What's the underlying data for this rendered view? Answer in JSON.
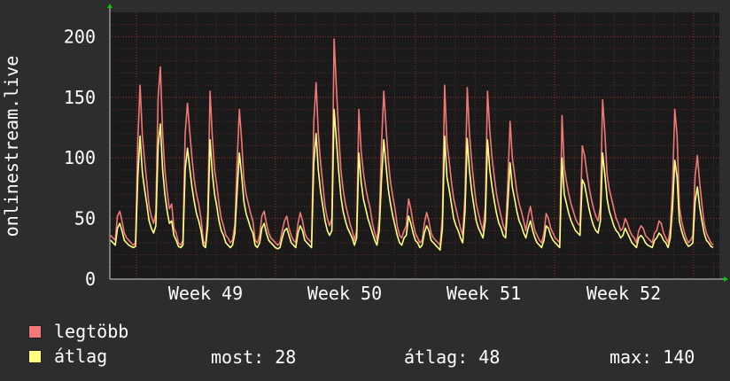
{
  "chart_data": {
    "type": "line",
    "ylabel": "onlinestream.live",
    "ylim": [
      0,
      220
    ],
    "yticks": [
      0,
      50,
      100,
      150,
      200
    ],
    "x_categories": [
      "Week 49",
      "Week 50",
      "Week 51",
      "Week 52"
    ],
    "grid": true,
    "legend_placement": "bottom-left",
    "colors": {
      "background": "#2d2d2d",
      "plot_background": "#1a1a1a",
      "grid_minor": "#5a2a2a",
      "grid_major": "#a03030",
      "max_series": "#f07878",
      "avg_series": "#ffff80",
      "arrow": "#00cc00"
    },
    "series": [
      {
        "name": "legtöbb",
        "color": "#f07878",
        "values": [
          36,
          34,
          32,
          52,
          56,
          48,
          38,
          34,
          32,
          30,
          28,
          30,
          115,
          160,
          118,
          98,
          80,
          60,
          52,
          46,
          55,
          150,
          175,
          120,
          90,
          72,
          58,
          62,
          42,
          38,
          30,
          28,
          32,
          120,
          145,
          122,
          100,
          82,
          70,
          62,
          50,
          32,
          28,
          55,
          155,
          118,
          90,
          78,
          62,
          50,
          44,
          36,
          34,
          30,
          32,
          45,
          95,
          140,
          115,
          82,
          70,
          62,
          54,
          48,
          32,
          30,
          36,
          52,
          56,
          46,
          38,
          34,
          32,
          30,
          28,
          30,
          40,
          48,
          52,
          42,
          36,
          32,
          30,
          46,
          55,
          48,
          38,
          34,
          32,
          30,
          130,
          162,
          120,
          96,
          78,
          60,
          50,
          44,
          50,
          198,
          158,
          122,
          90,
          74,
          62,
          54,
          46,
          40,
          32,
          40,
          140,
          105,
          88,
          75,
          66,
          58,
          46,
          38,
          32,
          50,
          110,
          155,
          126,
          98,
          80,
          68,
          58,
          44,
          36,
          34,
          40,
          44,
          66,
          58,
          46,
          38,
          34,
          30,
          32,
          46,
          55,
          48,
          38,
          34,
          32,
          30,
          28,
          52,
          160,
          112,
          98,
          80,
          66,
          58,
          50,
          42,
          36,
          70,
          158,
          120,
          96,
          78,
          62,
          54,
          46,
          40,
          60,
          155,
          122,
          100,
          84,
          70,
          60,
          52,
          44,
          40,
          80,
          130,
          100,
          86,
          72,
          62,
          56,
          48,
          40,
          52,
          60,
          48,
          40,
          36,
          32,
          30,
          38,
          54,
          50,
          42,
          38,
          34,
          32,
          30,
          135,
          92,
          80,
          70,
          62,
          56,
          50,
          46,
          44,
          110,
          102,
          88,
          76,
          66,
          58,
          52,
          48,
          60,
          148,
          120,
          86,
          74,
          66,
          58,
          50,
          46,
          40,
          42,
          50,
          46,
          40,
          36,
          34,
          30,
          40,
          44,
          42,
          36,
          34,
          32,
          30,
          38,
          40,
          48,
          46,
          38,
          34,
          30,
          42,
          78,
          140,
          118,
          60,
          48,
          40,
          34,
          30,
          32,
          36,
          85,
          102,
          80,
          62,
          46,
          38,
          34,
          30,
          28
        ]
      },
      {
        "name": "átlag",
        "color": "#ffff80",
        "values": [
          32,
          30,
          28,
          42,
          46,
          40,
          32,
          30,
          28,
          27,
          26,
          27,
          85,
          118,
          88,
          74,
          62,
          48,
          42,
          38,
          44,
          110,
          128,
          90,
          70,
          56,
          46,
          48,
          36,
          32,
          27,
          26,
          28,
          90,
          108,
          92,
          76,
          64,
          54,
          48,
          40,
          28,
          26,
          44,
          115,
          88,
          70,
          60,
          48,
          40,
          36,
          30,
          28,
          26,
          28,
          38,
          72,
          104,
          86,
          64,
          54,
          48,
          42,
          38,
          28,
          26,
          30,
          42,
          46,
          38,
          32,
          30,
          28,
          26,
          25,
          26,
          34,
          40,
          42,
          36,
          30,
          28,
          26,
          38,
          44,
          40,
          32,
          30,
          28,
          26,
          96,
          120,
          90,
          72,
          60,
          48,
          40,
          36,
          40,
          140,
          115,
          90,
          68,
          56,
          48,
          42,
          38,
          34,
          28,
          34,
          104,
          80,
          66,
          58,
          50,
          44,
          38,
          32,
          28,
          40,
          82,
          115,
          94,
          74,
          62,
          52,
          44,
          36,
          30,
          28,
          34,
          36,
          52,
          46,
          38,
          32,
          30,
          26,
          28,
          38,
          44,
          40,
          32,
          30,
          28,
          26,
          24,
          42,
          118,
          84,
          74,
          62,
          50,
          44,
          40,
          34,
          30,
          56,
          116,
          90,
          72,
          60,
          48,
          42,
          38,
          34,
          48,
          115,
          90,
          76,
          64,
          54,
          46,
          42,
          36,
          34,
          62,
          96,
          76,
          66,
          56,
          48,
          44,
          38,
          34,
          42,
          48,
          40,
          34,
          30,
          28,
          26,
          32,
          44,
          42,
          36,
          32,
          30,
          28,
          26,
          100,
          70,
          62,
          54,
          48,
          44,
          40,
          38,
          36,
          82,
          78,
          68,
          58,
          50,
          44,
          40,
          38,
          48,
          104,
          86,
          66,
          56,
          50,
          44,
          40,
          38,
          34,
          36,
          42,
          38,
          34,
          30,
          28,
          26,
          34,
          36,
          34,
          30,
          28,
          27,
          26,
          32,
          34,
          38,
          36,
          32,
          30,
          26,
          34,
          60,
          98,
          84,
          48,
          40,
          34,
          30,
          27,
          28,
          30,
          64,
          76,
          60,
          48,
          38,
          32,
          30,
          27,
          26
        ]
      }
    ]
  },
  "legend": [
    {
      "label": "legtöbb",
      "color": "#f07878"
    },
    {
      "label": "átlag",
      "color": "#ffff80"
    }
  ],
  "stats": {
    "current": "most: 28",
    "average": "átlag: 48",
    "max": "max: 140"
  }
}
